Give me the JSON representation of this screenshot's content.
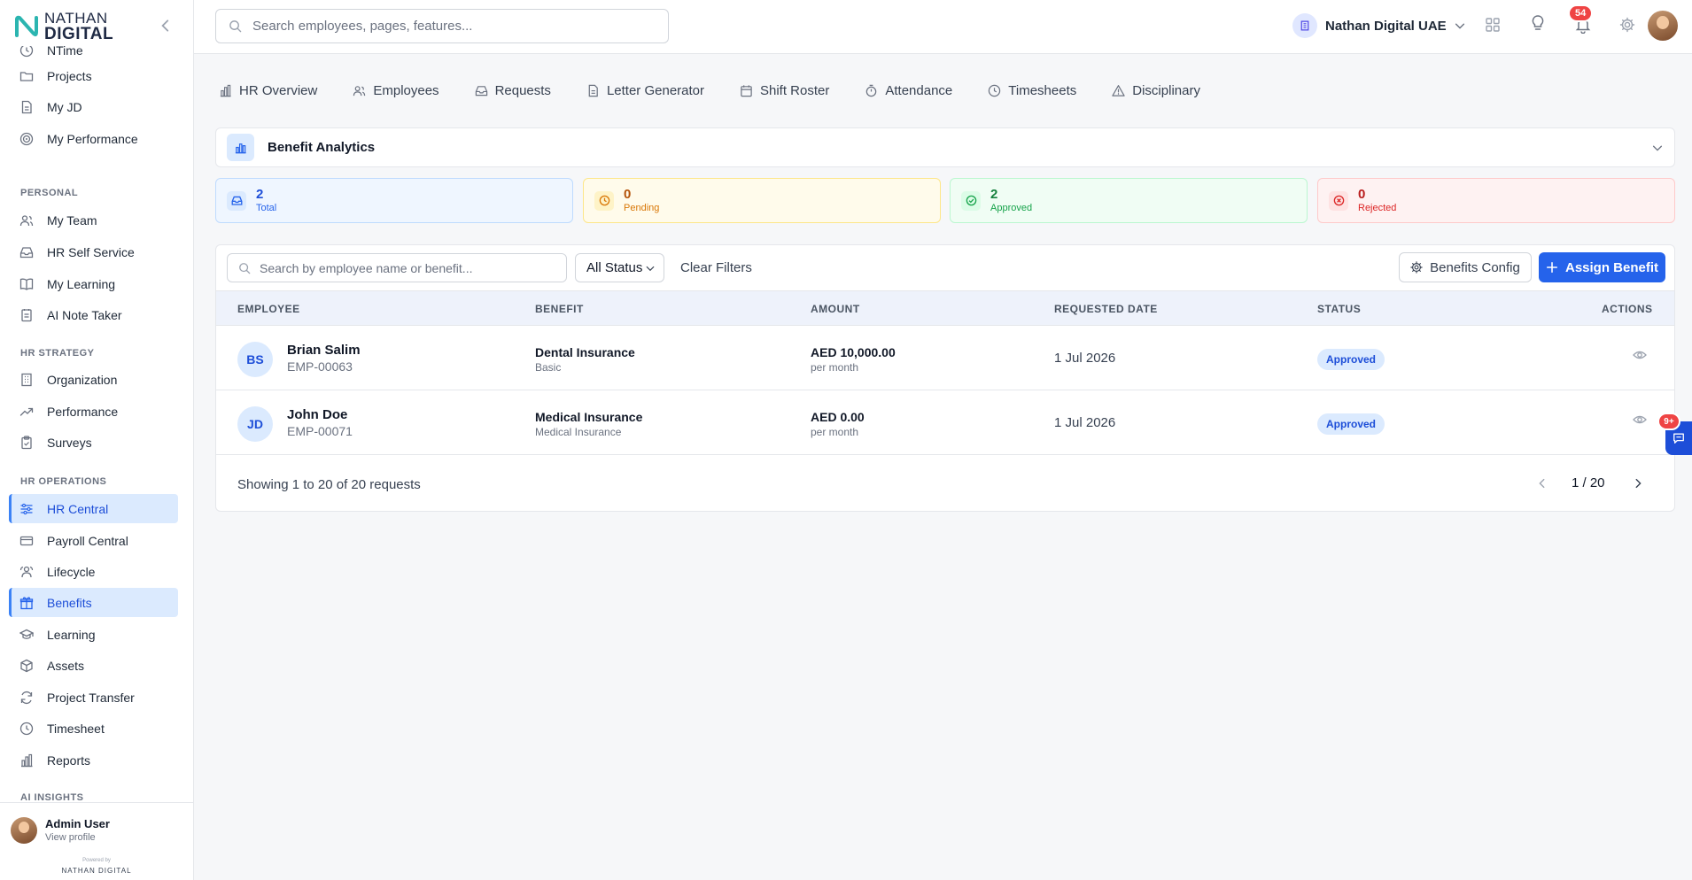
{
  "app": {
    "logo_line1": "NATHAN",
    "logo_line2": "DIGITAL",
    "accent_color": "#2563eb"
  },
  "sidebar": {
    "items_top": [
      {
        "label": "NTime",
        "icon": "clock-icon"
      },
      {
        "label": "Projects",
        "icon": "folder-icon"
      },
      {
        "label": "My JD",
        "icon": "file-icon"
      },
      {
        "label": "My Performance",
        "icon": "target-icon"
      }
    ],
    "section_personal": "PERSONAL",
    "items_personal": [
      {
        "label": "My Team",
        "icon": "users-icon"
      },
      {
        "label": "HR Self Service",
        "icon": "inbox-icon"
      },
      {
        "label": "My Learning",
        "icon": "book-icon"
      },
      {
        "label": "AI Note Taker",
        "icon": "notepad-icon"
      }
    ],
    "section_strategy": "HR STRATEGY",
    "items_strategy": [
      {
        "label": "Organization",
        "icon": "building-icon"
      },
      {
        "label": "Performance",
        "icon": "trend-icon"
      },
      {
        "label": "Surveys",
        "icon": "clipboard-icon"
      }
    ],
    "section_operations": "HR OPERATIONS",
    "items_operations": [
      {
        "label": "HR Central",
        "icon": "sliders-icon"
      },
      {
        "label": "Payroll Central",
        "icon": "card-icon"
      },
      {
        "label": "Lifecycle",
        "icon": "users-cycle-icon"
      },
      {
        "label": "Benefits",
        "icon": "gift-icon"
      },
      {
        "label": "Learning",
        "icon": "graduation-cap-icon"
      },
      {
        "label": "Assets",
        "icon": "box-icon"
      },
      {
        "label": "Project Transfer",
        "icon": "refresh-icon"
      },
      {
        "label": "Timesheet",
        "icon": "clock-icon"
      },
      {
        "label": "Reports",
        "icon": "bar-chart-icon"
      }
    ],
    "section_ai": "AI INSIGHTS",
    "user": {
      "name": "Admin User",
      "link": "View profile"
    },
    "powered_by": "Powered by",
    "powered_logo": "NATHAN DIGITAL"
  },
  "topbar": {
    "search_placeholder": "Search employees, pages, features...",
    "org_name": "Nathan Digital UAE",
    "notification_count": "54"
  },
  "tabs": [
    {
      "label": "HR Overview",
      "icon": "bar-chart-icon"
    },
    {
      "label": "Employees",
      "icon": "users-icon"
    },
    {
      "label": "Requests",
      "icon": "inbox-icon"
    },
    {
      "label": "Letter Generator",
      "icon": "file-icon"
    },
    {
      "label": "Shift Roster",
      "icon": "calendar-icon"
    },
    {
      "label": "Attendance",
      "icon": "timer-icon"
    },
    {
      "label": "Timesheets",
      "icon": "clock-icon"
    },
    {
      "label": "Disciplinary",
      "icon": "warning-icon"
    }
  ],
  "analytics": {
    "title": "Benefit Analytics"
  },
  "stats": {
    "total": {
      "value": "2",
      "label": "Total"
    },
    "pending": {
      "value": "0",
      "label": "Pending"
    },
    "approved": {
      "value": "2",
      "label": "Approved"
    },
    "rejected": {
      "value": "0",
      "label": "Rejected"
    }
  },
  "filters": {
    "search_placeholder": "Search by employee name or benefit...",
    "status_value": "All Status",
    "clear_label": "Clear Filters",
    "config_label": "Benefits Config",
    "assign_label": "Assign Benefit"
  },
  "table": {
    "headers": {
      "employee": "EMPLOYEE",
      "benefit": "BENEFIT",
      "amount": "AMOUNT",
      "requested_date": "REQUESTED DATE",
      "status": "STATUS",
      "actions": "ACTIONS"
    },
    "rows": [
      {
        "initials": "BS",
        "name": "Brian Salim",
        "emp_id": "EMP-00063",
        "benefit": "Dental Insurance",
        "benefit_type": "Basic",
        "amount": "AED 10,000.00",
        "period": "per month",
        "date": "1 Jul 2026",
        "status": "Approved"
      },
      {
        "initials": "JD",
        "name": "John Doe",
        "emp_id": "EMP-00071",
        "benefit": "Medical Insurance",
        "benefit_type": "Medical Insurance",
        "amount": "AED 0.00",
        "period": "per month",
        "date": "1 Jul 2026",
        "status": "Approved"
      }
    ],
    "footer_text": "Showing 1 to 20 of 20 requests",
    "page_indicator": "1 / 20"
  },
  "chat": {
    "badge": "9+"
  }
}
